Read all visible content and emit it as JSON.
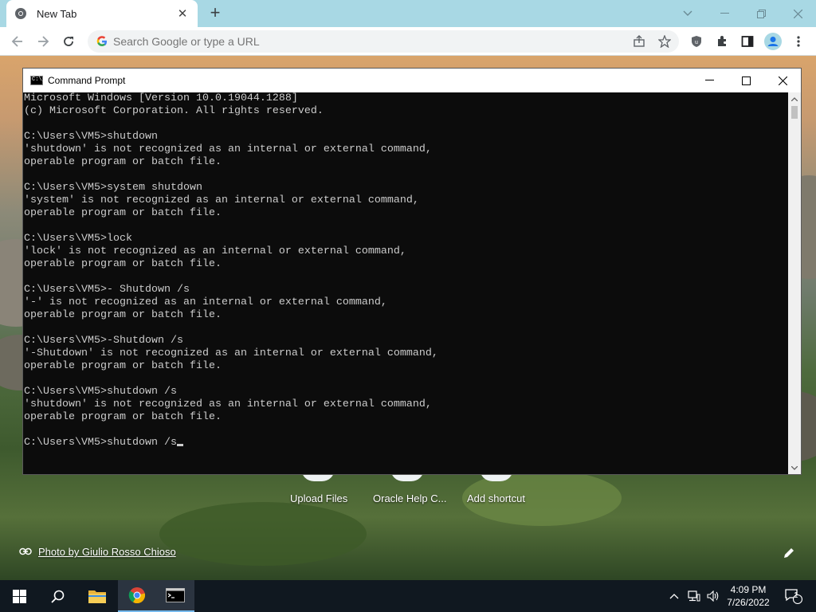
{
  "browser": {
    "tab_title": "New Tab",
    "tab_close": "✕",
    "new_tab": "+",
    "omnibox_placeholder": "Search Google or type a URL"
  },
  "ntp": {
    "shortcuts": [
      {
        "label": "Upload Files"
      },
      {
        "label": "Oracle Help C..."
      },
      {
        "label": "Add shortcut"
      }
    ],
    "photo_credit": "Photo by Giulio Rosso Chioso"
  },
  "cmd": {
    "title": "Command Prompt",
    "icon_text": "C:\\_",
    "lines": [
      "Microsoft Windows [Version 10.0.19044.1288]",
      "(c) Microsoft Corporation. All rights reserved.",
      "",
      "C:\\Users\\VM5>shutdown",
      "'shutdown' is not recognized as an internal or external command,",
      "operable program or batch file.",
      "",
      "C:\\Users\\VM5>system shutdown",
      "'system' is not recognized as an internal or external command,",
      "operable program or batch file.",
      "",
      "C:\\Users\\VM5>lock",
      "'lock' is not recognized as an internal or external command,",
      "operable program or batch file.",
      "",
      "C:\\Users\\VM5>- Shutdown /s",
      "'-' is not recognized as an internal or external command,",
      "operable program or batch file.",
      "",
      "C:\\Users\\VM5>-Shutdown /s",
      "'-Shutdown' is not recognized as an internal or external command,",
      "operable program or batch file.",
      "",
      "C:\\Users\\VM5>shutdown /s",
      "'shutdown' is not recognized as an internal or external command,",
      "operable program or batch file.",
      ""
    ],
    "prompt_line": "C:\\Users\\VM5>shutdown /s"
  },
  "taskbar": {
    "time": "4:09 PM",
    "date": "7/26/2022",
    "notification_count": "1"
  },
  "colors": {
    "console_bg": "#0c0c0c",
    "console_text": "#cccccc",
    "tabstrip": "#a8d8e4",
    "taskbar": "#101820"
  }
}
